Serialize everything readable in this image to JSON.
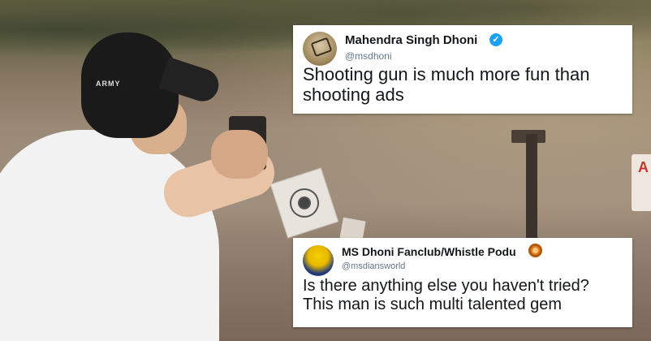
{
  "scene": {
    "cap_text": "ARMY",
    "sign_text": "A"
  },
  "tweets": [
    {
      "name": "Mahendra Singh Dhoni",
      "handle": "@msdhoni",
      "verified_icon": "verified-badge-icon",
      "line1": "Shooting gun is much more fun than",
      "line2": "shooting ads"
    },
    {
      "name": "MS Dhoni Fanclub/Whistle Podu",
      "handle": "@msdiansworld",
      "emoji_icon": "lion-face-icon",
      "line1": "Is there anything else you haven't tried?",
      "line2": "This man is such multi talented gem"
    }
  ],
  "colors": {
    "verified_blue": "#1da1f2",
    "text": "#14171a",
    "handle": "#657786"
  }
}
